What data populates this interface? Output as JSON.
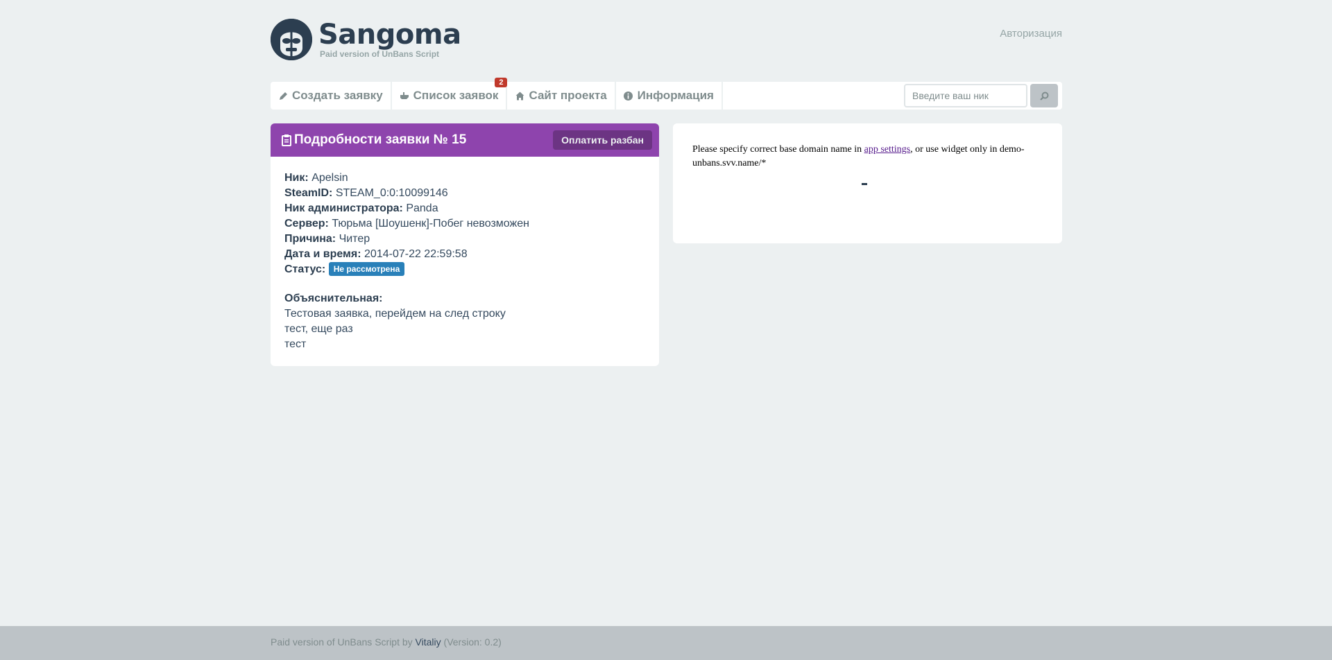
{
  "header": {
    "logo_title": "Sangoma",
    "logo_subtitle": "Paid version of UnBans Script",
    "auth_link": "Авторизация"
  },
  "nav": {
    "items": [
      {
        "label": "Создать заявку",
        "icon": "pencil-icon"
      },
      {
        "label": "Список заявок",
        "icon": "hand-icon",
        "badge": "2"
      },
      {
        "label": "Сайт проекта",
        "icon": "home-icon"
      },
      {
        "label": "Информация",
        "icon": "info-icon"
      }
    ],
    "search_placeholder": "Введите ваш ник",
    "search_icon": "search-icon"
  },
  "details": {
    "title": "Подробности заявки № 15",
    "pay_button": "Оплатить разбан",
    "fields": [
      {
        "label": "Ник:",
        "value": "Apelsin"
      },
      {
        "label": "SteamID:",
        "value": "STEAM_0:0:10099146"
      },
      {
        "label": "Ник администратора:",
        "value": "Panda"
      },
      {
        "label": "Сервер:",
        "value": "Тюрьма [Шоушенк]-Побег невозможен"
      },
      {
        "label": "Причина:",
        "value": "Читер"
      },
      {
        "label": "Дата и время:",
        "value": "2014-07-22 22:59:58"
      }
    ],
    "status_label": "Статус:",
    "status_value": "Не рассмотрена",
    "status_color": "#2980b9",
    "explanation_label": "Объяснительная:",
    "explanation_lines": [
      "Тестовая заявка, перейдем на след строку",
      "тест, еще раз",
      "тест"
    ]
  },
  "widget": {
    "text_before": "Please specify correct base domain name in ",
    "link_text": "app settings",
    "text_after": ", or use widget only in demo-unbans.svv.name/*"
  },
  "footer": {
    "prefix": "Paid version of UnBans Script by ",
    "author": "Vitaliy",
    "version": " (Version: 0.2)"
  },
  "colors": {
    "background": "#ecf0f1",
    "panel_header": "#8e44ad",
    "pay_button": "#6c3483",
    "badge": "#c0392b",
    "footer": "#bdc3c7"
  }
}
